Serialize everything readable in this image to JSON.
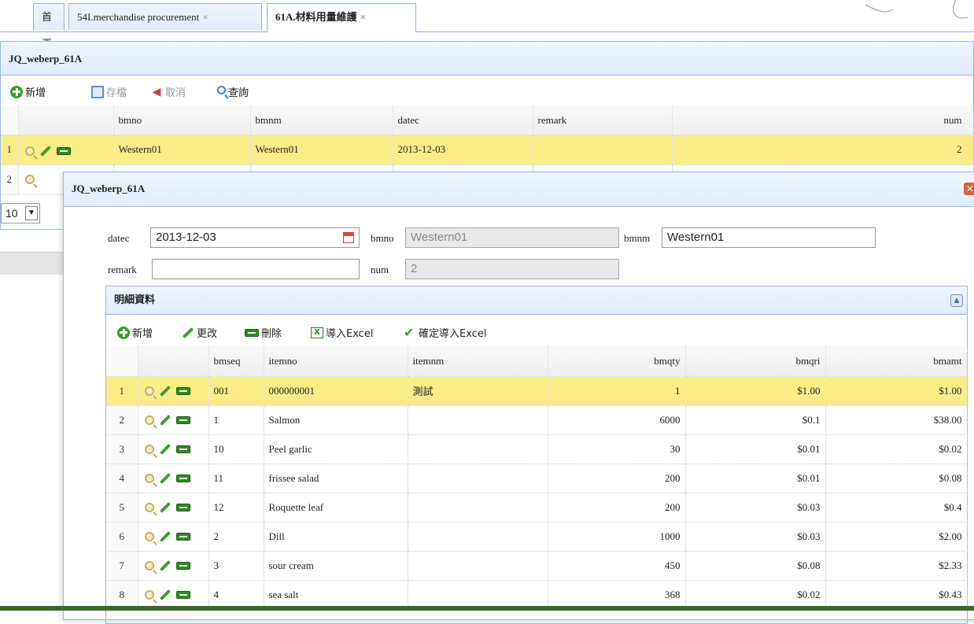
{
  "tabs": [
    {
      "label": "首頁"
    },
    {
      "label": "54I.merchandise procurement",
      "close": "×"
    },
    {
      "label": "61A.材料用量維護",
      "close": "×"
    }
  ],
  "back_panel": {
    "title": "JQ_weberp_61A",
    "toolbar": {
      "add": "新增",
      "save": "存檔",
      "cancel": "取消",
      "query": "查詢"
    },
    "columns": [
      "bmno",
      "bmnm",
      "datec",
      "remark",
      "num"
    ],
    "rows": [
      {
        "rownum": "1",
        "bmno": "Western01",
        "bmnm": "Western01",
        "datec": "2013-12-03",
        "remark": "",
        "num": "2"
      },
      {
        "rownum": "2",
        "bmno": "",
        "bmnm": "",
        "datec": "",
        "remark": "",
        "num": ""
      }
    ],
    "page_size": "10"
  },
  "dialog": {
    "title": "JQ_weberp_61A",
    "close": "✕",
    "form": {
      "datec_label": "datec",
      "datec_value": "2013-12-03",
      "bmno_label": "bmno",
      "bmno_value": "Western01",
      "bmnm_label": "bmnm",
      "bmnm_value": "Western01",
      "remark_label": "remark",
      "remark_value": "",
      "num_label": "num",
      "num_value": "2"
    },
    "detail": {
      "title": "明細資料",
      "toolbar": {
        "add": "新增",
        "edit": "更改",
        "delete": "刪除",
        "import": "導入Excel",
        "confirm_import": "確定導入Excel"
      },
      "columns": [
        "bmseq",
        "itemno",
        "itemnm",
        "bmqty",
        "bmqri",
        "bmamt"
      ],
      "rows": [
        {
          "rownum": "1",
          "bmseq": "001",
          "itemno": "000000001",
          "itemnm": "測試",
          "bmqty": "1",
          "bmqri": "$1.00",
          "bmamt": "$1.00"
        },
        {
          "rownum": "2",
          "bmseq": "1",
          "itemno": "Salmon",
          "itemnm": "",
          "bmqty": "6000",
          "bmqri": "$0.1",
          "bmamt": "$38.00"
        },
        {
          "rownum": "3",
          "bmseq": "10",
          "itemno": "Peel garlic",
          "itemnm": "",
          "bmqty": "30",
          "bmqri": "$0.01",
          "bmamt": "$0.02"
        },
        {
          "rownum": "4",
          "bmseq": "11",
          "itemno": "frissee salad",
          "itemnm": "",
          "bmqty": "200",
          "bmqri": "$0.01",
          "bmamt": "$0.08"
        },
        {
          "rownum": "5",
          "bmseq": "12",
          "itemno": "Roquette leaf",
          "itemnm": "",
          "bmqty": "200",
          "bmqri": "$0.03",
          "bmamt": "$0.4"
        },
        {
          "rownum": "6",
          "bmseq": "2",
          "itemno": "Dill",
          "itemnm": "",
          "bmqty": "1000",
          "bmqri": "$0.03",
          "bmamt": "$2.00"
        },
        {
          "rownum": "7",
          "bmseq": "3",
          "itemno": "sour cream",
          "itemnm": "",
          "bmqty": "450",
          "bmqri": "$0.08",
          "bmamt": "$2.33"
        },
        {
          "rownum": "8",
          "bmseq": "4",
          "itemno": "sea salt",
          "itemnm": "",
          "bmqty": "368",
          "bmqri": "$0.02",
          "bmamt": "$0.43"
        }
      ]
    }
  },
  "colors": {
    "accent": "#95b8e7",
    "selected_row": "#fbec88",
    "header_bg": "#e0ecff"
  }
}
